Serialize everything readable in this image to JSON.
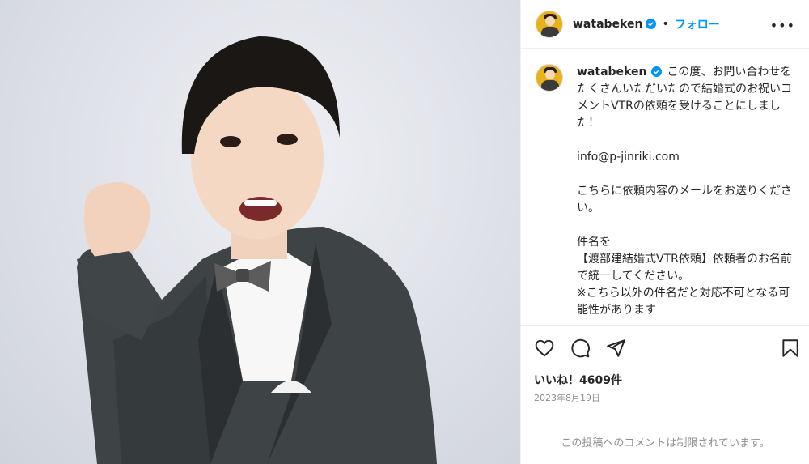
{
  "post": {
    "author": "watabeken",
    "verified": true,
    "header_separator": "•",
    "follow_label": "フォロー",
    "more_icon": "more-horizontal-icon",
    "caption": "この度、お問い合わせをたくさんいただいたので結婚式のお祝いコメントVTRの依頼を受けることにしました！\n\ninfo@p-jinriki.com\n\nこちらに依頼内容のメールをお送りください。\n\n件名を\n【渡部建結婚式VTR依頼】依頼者のお名前\nで統一してください。\n※こちら以外の件名だと対応不可となる可能性があります",
    "likes": "いいね！4609件",
    "date": "2023年8月19日",
    "comments_disabled": "この投稿へのコメントは制限されています。"
  },
  "icons": {
    "like": "heart-icon",
    "comment": "comment-icon",
    "share": "paper-plane-icon",
    "save": "bookmark-icon",
    "verified": "verified-badge-icon"
  },
  "colors": {
    "link": "#0095f6",
    "verified": "#0095f6",
    "muted": "#8e8e8e",
    "border": "#efefef",
    "avatar_bg": "#e8b21a"
  }
}
